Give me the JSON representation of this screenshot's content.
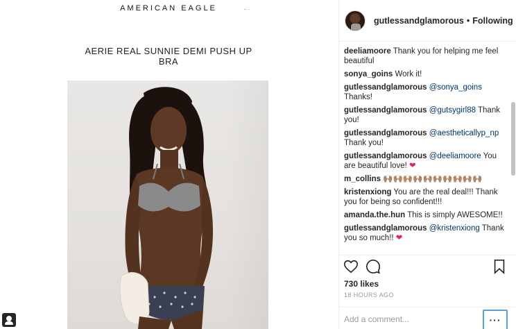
{
  "post_image": {
    "brand": "AMERICAN EAGLE",
    "stray_mark": "- ·",
    "product_title": "AERIE REAL SUNNIE DEMI PUSH UP BRA"
  },
  "header": {
    "username": "gutlessandglamorous",
    "separator": "•",
    "follow_status": "Following"
  },
  "comments": [
    {
      "user": "deeliamoore",
      "mention": "",
      "text": "Thank you for helping me feel beautiful",
      "heart": ""
    },
    {
      "user": "sonya_goins",
      "mention": "",
      "text": "Work it!",
      "heart": ""
    },
    {
      "user": "gutlessandglamorous",
      "mention": "@sonya_goins",
      "text": "Thanks!",
      "heart": ""
    },
    {
      "user": "gutlessandglamorous",
      "mention": "@gutsygirl88",
      "text": "Thank you!",
      "heart": ""
    },
    {
      "user": "gutlessandglamorous",
      "mention": "@aestheticallyp_np",
      "text": "Thank you!",
      "heart": ""
    },
    {
      "user": "gutlessandglamorous",
      "mention": "@deeliamoore",
      "text": "You are beautiful love!",
      "heart": "❤"
    },
    {
      "user": "m_collins",
      "mention": "",
      "text": "🙌🏽🙌🏽🙌🏽🙌🏽🙌🏽🙌🏽🙌🏽🙌🏽🙌🏽🙌🏽",
      "heart": ""
    },
    {
      "user": "kristenxiong",
      "mention": "",
      "text": "You are the real deal!!! Thank you for being so confident!!!",
      "heart": ""
    },
    {
      "user": "amanda.the.hun",
      "mention": "",
      "text": "This is simply AWESOME!!",
      "heart": ""
    },
    {
      "user": "gutlessandglamorous",
      "mention": "@kristenxiong",
      "text": "Thank you so much!!",
      "heart": "❤"
    }
  ],
  "actions": {
    "like_icon": "heart-outline-icon",
    "comment_icon": "speech-bubble-icon",
    "save_icon": "bookmark-icon",
    "likes": "730 likes",
    "timestamp": "18 HOURS AGO",
    "comment_placeholder": "Add a comment...",
    "more": "···"
  },
  "colors": {
    "mention": "#003569",
    "heart": "#e0245e",
    "focus_outline": "#5b9dd9"
  }
}
